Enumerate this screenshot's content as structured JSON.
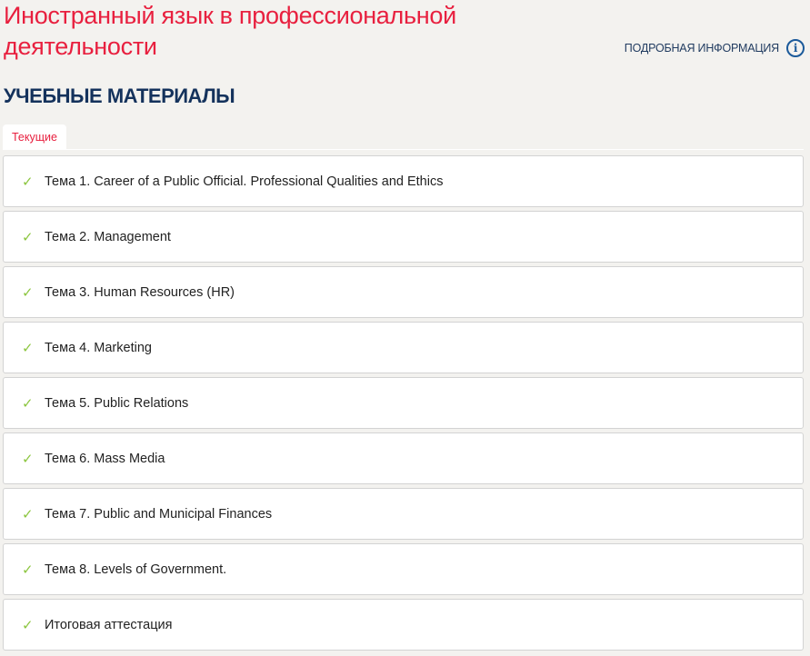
{
  "header": {
    "title": "Иностранный язык в профессиональной деятельности",
    "info_link": "ПОДРОБНАЯ ИНФОРМАЦИЯ"
  },
  "section_title": "УЧЕБНЫЕ МАТЕРИАЛЫ",
  "tabs": [
    {
      "label": "Текущие",
      "active": true
    }
  ],
  "items": [
    {
      "label": "Тема 1. Career of a Public Official. Professional Qualities and Ethics"
    },
    {
      "label": "Тема 2. Management"
    },
    {
      "label": "Тема 3. Human Resources (HR)"
    },
    {
      "label": "Тема 4. Marketing"
    },
    {
      "label": "Тема 5. Public Relations"
    },
    {
      "label": "Тема 6. Mass Media"
    },
    {
      "label": "Тема 7. Public and Municipal Finances"
    },
    {
      "label": "Тема 8. Levels of Government."
    },
    {
      "label": "Итоговая аттестация"
    }
  ],
  "colors": {
    "accent": "#e8203f",
    "heading": "#14325c",
    "check": "#8cc63f"
  }
}
